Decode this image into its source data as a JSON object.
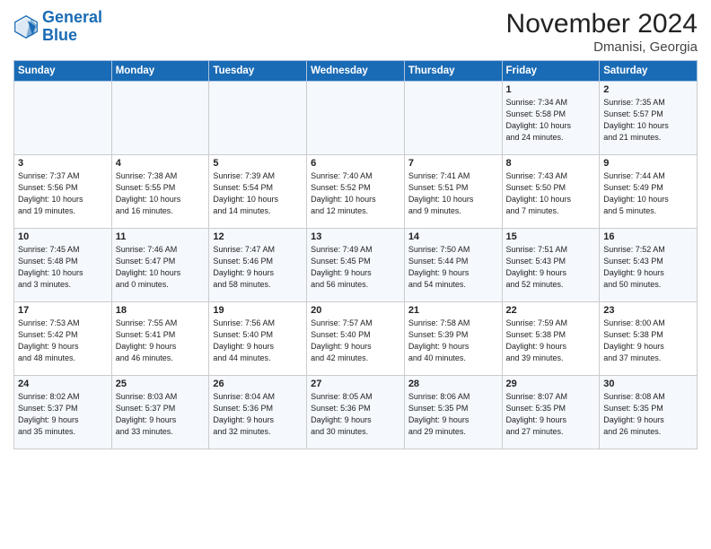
{
  "header": {
    "logo_line1": "General",
    "logo_line2": "Blue",
    "title": "November 2024",
    "subtitle": "Dmanisi, Georgia"
  },
  "days_of_week": [
    "Sunday",
    "Monday",
    "Tuesday",
    "Wednesday",
    "Thursday",
    "Friday",
    "Saturday"
  ],
  "weeks": [
    [
      {
        "day": "",
        "info": ""
      },
      {
        "day": "",
        "info": ""
      },
      {
        "day": "",
        "info": ""
      },
      {
        "day": "",
        "info": ""
      },
      {
        "day": "",
        "info": ""
      },
      {
        "day": "1",
        "info": "Sunrise: 7:34 AM\nSunset: 5:58 PM\nDaylight: 10 hours\nand 24 minutes."
      },
      {
        "day": "2",
        "info": "Sunrise: 7:35 AM\nSunset: 5:57 PM\nDaylight: 10 hours\nand 21 minutes."
      }
    ],
    [
      {
        "day": "3",
        "info": "Sunrise: 7:37 AM\nSunset: 5:56 PM\nDaylight: 10 hours\nand 19 minutes."
      },
      {
        "day": "4",
        "info": "Sunrise: 7:38 AM\nSunset: 5:55 PM\nDaylight: 10 hours\nand 16 minutes."
      },
      {
        "day": "5",
        "info": "Sunrise: 7:39 AM\nSunset: 5:54 PM\nDaylight: 10 hours\nand 14 minutes."
      },
      {
        "day": "6",
        "info": "Sunrise: 7:40 AM\nSunset: 5:52 PM\nDaylight: 10 hours\nand 12 minutes."
      },
      {
        "day": "7",
        "info": "Sunrise: 7:41 AM\nSunset: 5:51 PM\nDaylight: 10 hours\nand 9 minutes."
      },
      {
        "day": "8",
        "info": "Sunrise: 7:43 AM\nSunset: 5:50 PM\nDaylight: 10 hours\nand 7 minutes."
      },
      {
        "day": "9",
        "info": "Sunrise: 7:44 AM\nSunset: 5:49 PM\nDaylight: 10 hours\nand 5 minutes."
      }
    ],
    [
      {
        "day": "10",
        "info": "Sunrise: 7:45 AM\nSunset: 5:48 PM\nDaylight: 10 hours\nand 3 minutes."
      },
      {
        "day": "11",
        "info": "Sunrise: 7:46 AM\nSunset: 5:47 PM\nDaylight: 10 hours\nand 0 minutes."
      },
      {
        "day": "12",
        "info": "Sunrise: 7:47 AM\nSunset: 5:46 PM\nDaylight: 9 hours\nand 58 minutes."
      },
      {
        "day": "13",
        "info": "Sunrise: 7:49 AM\nSunset: 5:45 PM\nDaylight: 9 hours\nand 56 minutes."
      },
      {
        "day": "14",
        "info": "Sunrise: 7:50 AM\nSunset: 5:44 PM\nDaylight: 9 hours\nand 54 minutes."
      },
      {
        "day": "15",
        "info": "Sunrise: 7:51 AM\nSunset: 5:43 PM\nDaylight: 9 hours\nand 52 minutes."
      },
      {
        "day": "16",
        "info": "Sunrise: 7:52 AM\nSunset: 5:43 PM\nDaylight: 9 hours\nand 50 minutes."
      }
    ],
    [
      {
        "day": "17",
        "info": "Sunrise: 7:53 AM\nSunset: 5:42 PM\nDaylight: 9 hours\nand 48 minutes."
      },
      {
        "day": "18",
        "info": "Sunrise: 7:55 AM\nSunset: 5:41 PM\nDaylight: 9 hours\nand 46 minutes."
      },
      {
        "day": "19",
        "info": "Sunrise: 7:56 AM\nSunset: 5:40 PM\nDaylight: 9 hours\nand 44 minutes."
      },
      {
        "day": "20",
        "info": "Sunrise: 7:57 AM\nSunset: 5:40 PM\nDaylight: 9 hours\nand 42 minutes."
      },
      {
        "day": "21",
        "info": "Sunrise: 7:58 AM\nSunset: 5:39 PM\nDaylight: 9 hours\nand 40 minutes."
      },
      {
        "day": "22",
        "info": "Sunrise: 7:59 AM\nSunset: 5:38 PM\nDaylight: 9 hours\nand 39 minutes."
      },
      {
        "day": "23",
        "info": "Sunrise: 8:00 AM\nSunset: 5:38 PM\nDaylight: 9 hours\nand 37 minutes."
      }
    ],
    [
      {
        "day": "24",
        "info": "Sunrise: 8:02 AM\nSunset: 5:37 PM\nDaylight: 9 hours\nand 35 minutes."
      },
      {
        "day": "25",
        "info": "Sunrise: 8:03 AM\nSunset: 5:37 PM\nDaylight: 9 hours\nand 33 minutes."
      },
      {
        "day": "26",
        "info": "Sunrise: 8:04 AM\nSunset: 5:36 PM\nDaylight: 9 hours\nand 32 minutes."
      },
      {
        "day": "27",
        "info": "Sunrise: 8:05 AM\nSunset: 5:36 PM\nDaylight: 9 hours\nand 30 minutes."
      },
      {
        "day": "28",
        "info": "Sunrise: 8:06 AM\nSunset: 5:35 PM\nDaylight: 9 hours\nand 29 minutes."
      },
      {
        "day": "29",
        "info": "Sunrise: 8:07 AM\nSunset: 5:35 PM\nDaylight: 9 hours\nand 27 minutes."
      },
      {
        "day": "30",
        "info": "Sunrise: 8:08 AM\nSunset: 5:35 PM\nDaylight: 9 hours\nand 26 minutes."
      }
    ]
  ]
}
